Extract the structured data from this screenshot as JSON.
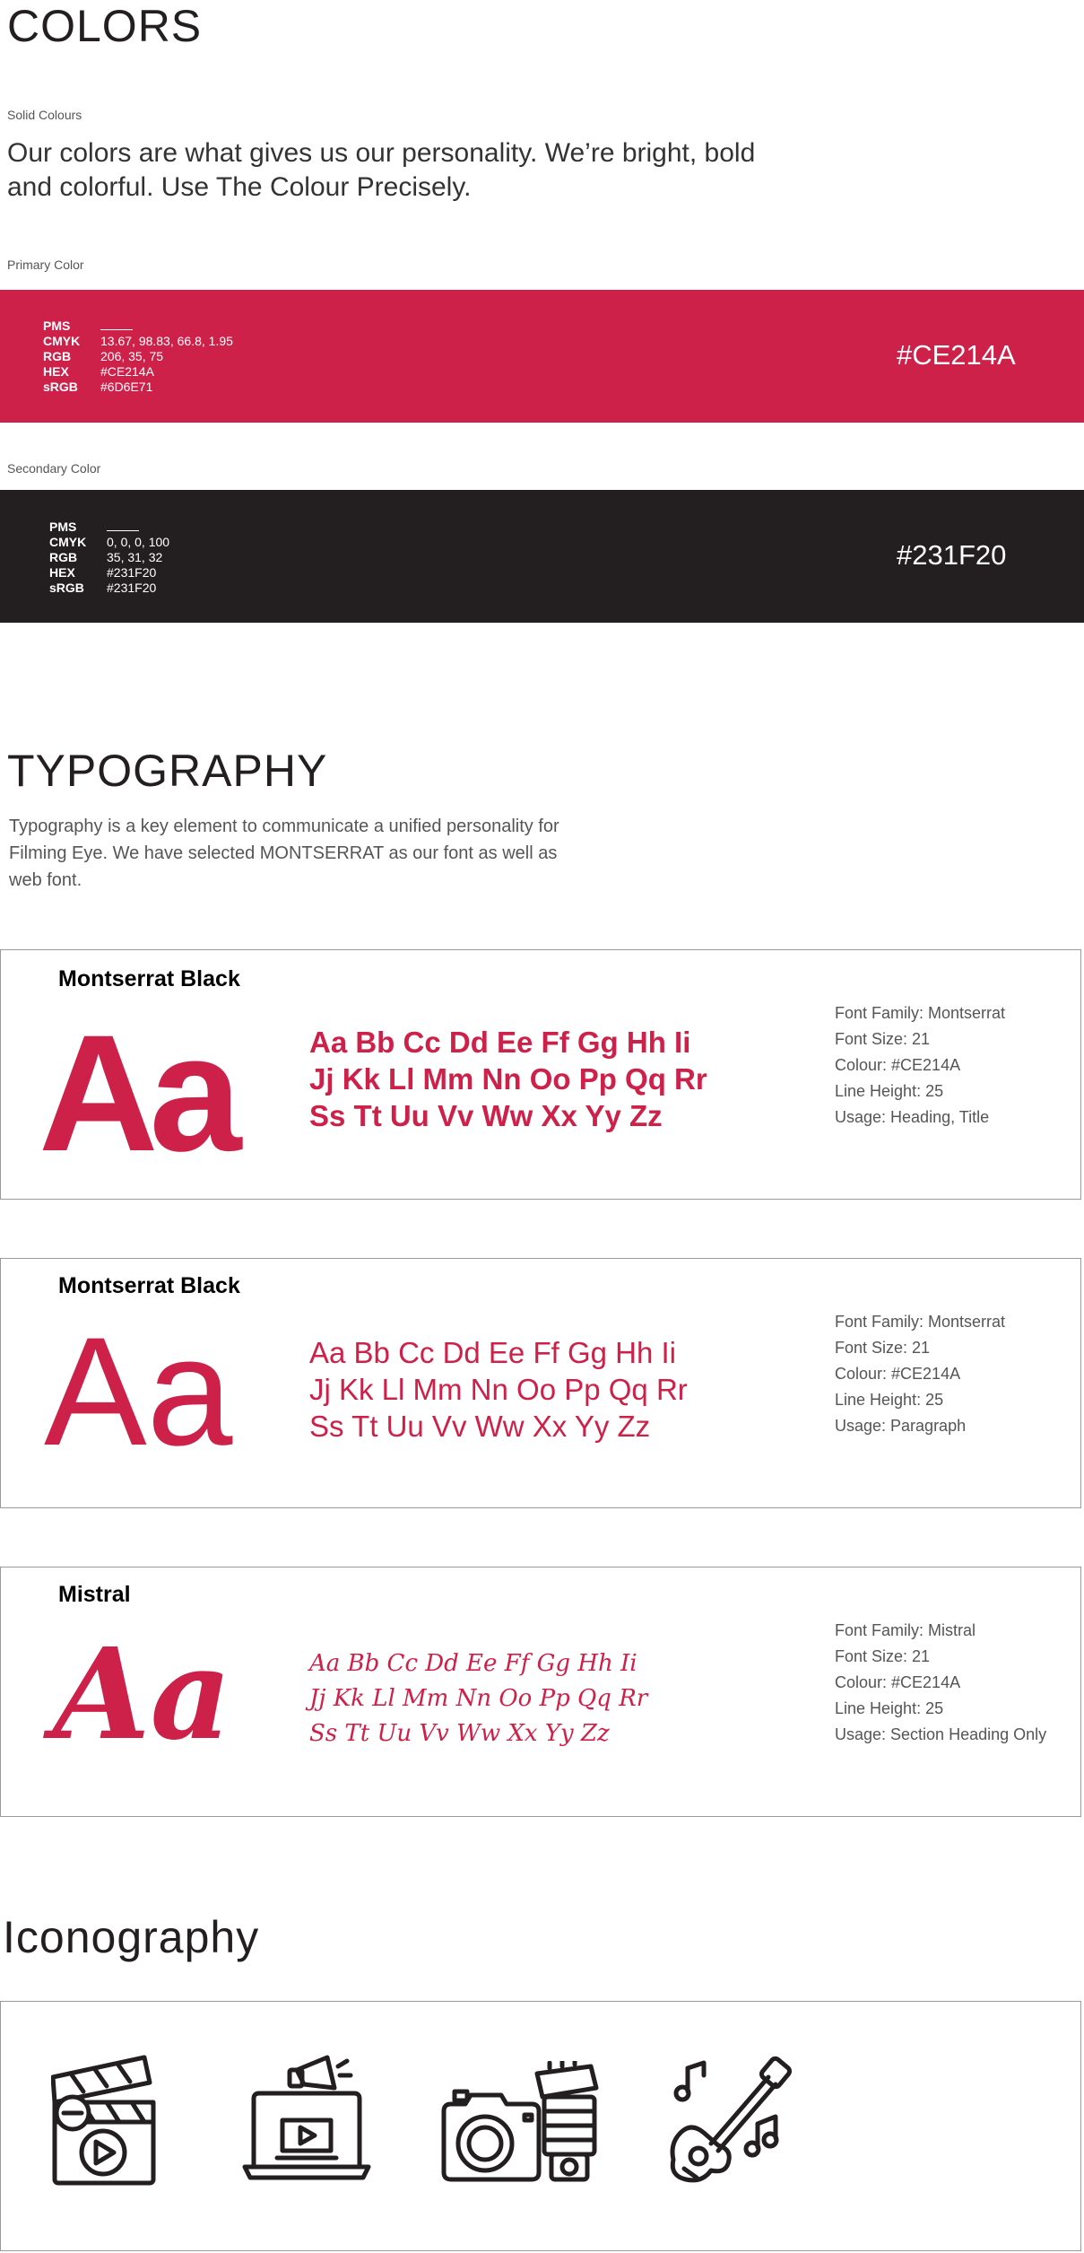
{
  "colors": {
    "title": "COLORS",
    "solid_label": "Solid Colours",
    "intro": "Our colors are what gives us our personality. We’re bright, bold and colorful. Use The Colour Precisely.",
    "primary": {
      "label": "Primary Color",
      "hex_display": "#CE214A",
      "swatch": "#CE214A",
      "specs": [
        {
          "key": "PMS",
          "value": ""
        },
        {
          "key": "CMYK",
          "value": "13.67, 98.83, 66.8, 1.95"
        },
        {
          "key": "RGB",
          "value": "206, 35, 75"
        },
        {
          "key": "HEX",
          "value": "#CE214A"
        },
        {
          "key": "sRGB",
          "value": "#6D6E71"
        }
      ]
    },
    "secondary": {
      "label": "Secondary Color",
      "hex_display": "#231F20",
      "swatch": "#231F20",
      "specs": [
        {
          "key": "PMS",
          "value": ""
        },
        {
          "key": "CMYK",
          "value": "0, 0, 0, 100"
        },
        {
          "key": "RGB",
          "value": "35, 31, 32"
        },
        {
          "key": "HEX",
          "value": "#231F20"
        },
        {
          "key": "sRGB",
          "value": "#231F20"
        }
      ]
    }
  },
  "typography": {
    "title": "TYPOGRAPHY",
    "description": "Typography is a key element to communicate a unified personality for Filming Eye.  We have selected MONTSERRAT as our font as well as web font.",
    "cards": [
      {
        "name": "Montserrat Black",
        "sample": "Aa",
        "alphabet": [
          "Aa Bb Cc Dd Ee Ff Gg Hh Ii",
          "Jj Kk Ll Mm Nn Oo Pp Qq Rr",
          "Ss Tt Uu Vv Ww Xx Yy Zz"
        ],
        "specs": [
          "Font Family: Montserrat",
          "Font Size: 21",
          "Colour: #CE214A",
          "Line Height: 25",
          "Usage: Heading, Title"
        ]
      },
      {
        "name": "Montserrat Black",
        "sample": "Aa",
        "alphabet": [
          "Aa Bb Cc Dd Ee Ff Gg Hh Ii",
          "Jj Kk Ll Mm Nn Oo Pp Qq Rr",
          "Ss Tt Uu Vv Ww Xx Yy Zz"
        ],
        "specs": [
          "Font Family: Montserrat",
          "Font Size: 21",
          "Colour: #CE214A",
          "Line Height: 25",
          "Usage: Paragraph"
        ]
      },
      {
        "name": "Mistral",
        "sample": "Aa",
        "alphabet": [
          "Aa Bb Cc Dd Ee Ff Gg Hh Ii",
          "Jj Kk Ll Mm Nn Oo Pp Qq Rr",
          "Ss Tt Uu Vv Ww Xx Yy Zz"
        ],
        "specs": [
          "Font Family: Mistral",
          "Font Size: 21",
          "Colour: #CE214A",
          "Line Height: 25",
          "Usage: Section Heading Only"
        ]
      }
    ]
  },
  "iconography": {
    "title": "Iconography",
    "icons": [
      "clapperboard-icon",
      "laptop-video-megaphone-icon",
      "camera-lens-icon",
      "guitar-music-icon"
    ]
  },
  "accent": "#CE214A",
  "dark": "#231F20"
}
